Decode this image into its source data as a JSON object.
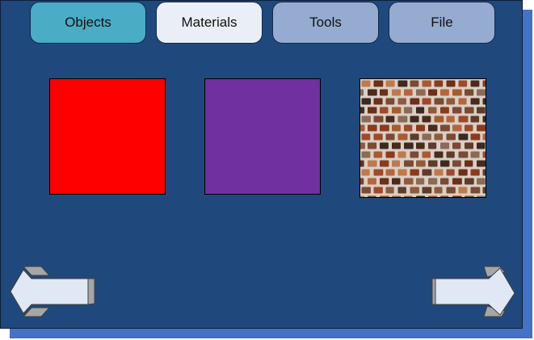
{
  "tabs": [
    {
      "label": "Objects",
      "color": "#4bacc6",
      "selected": false
    },
    {
      "label": "Materials",
      "color": "#eaeef7",
      "selected": true
    },
    {
      "label": "Tools",
      "color": "#95abd0",
      "selected": false
    },
    {
      "label": "File",
      "color": "#95abd0",
      "selected": false
    }
  ],
  "materials": [
    {
      "name": "red",
      "color": "#ff0000"
    },
    {
      "name": "purple",
      "color": "#7030a0"
    },
    {
      "name": "brick-texture",
      "color": "#8b4a2b"
    }
  ],
  "navigation": {
    "previous": "left-arrow-icon",
    "next": "right-arrow-icon"
  },
  "colors": {
    "panel": "#1f497d",
    "shadow": "#4472c4",
    "arrow_face": "#dfe8f4",
    "arrow_side": "#a6a6a6"
  }
}
